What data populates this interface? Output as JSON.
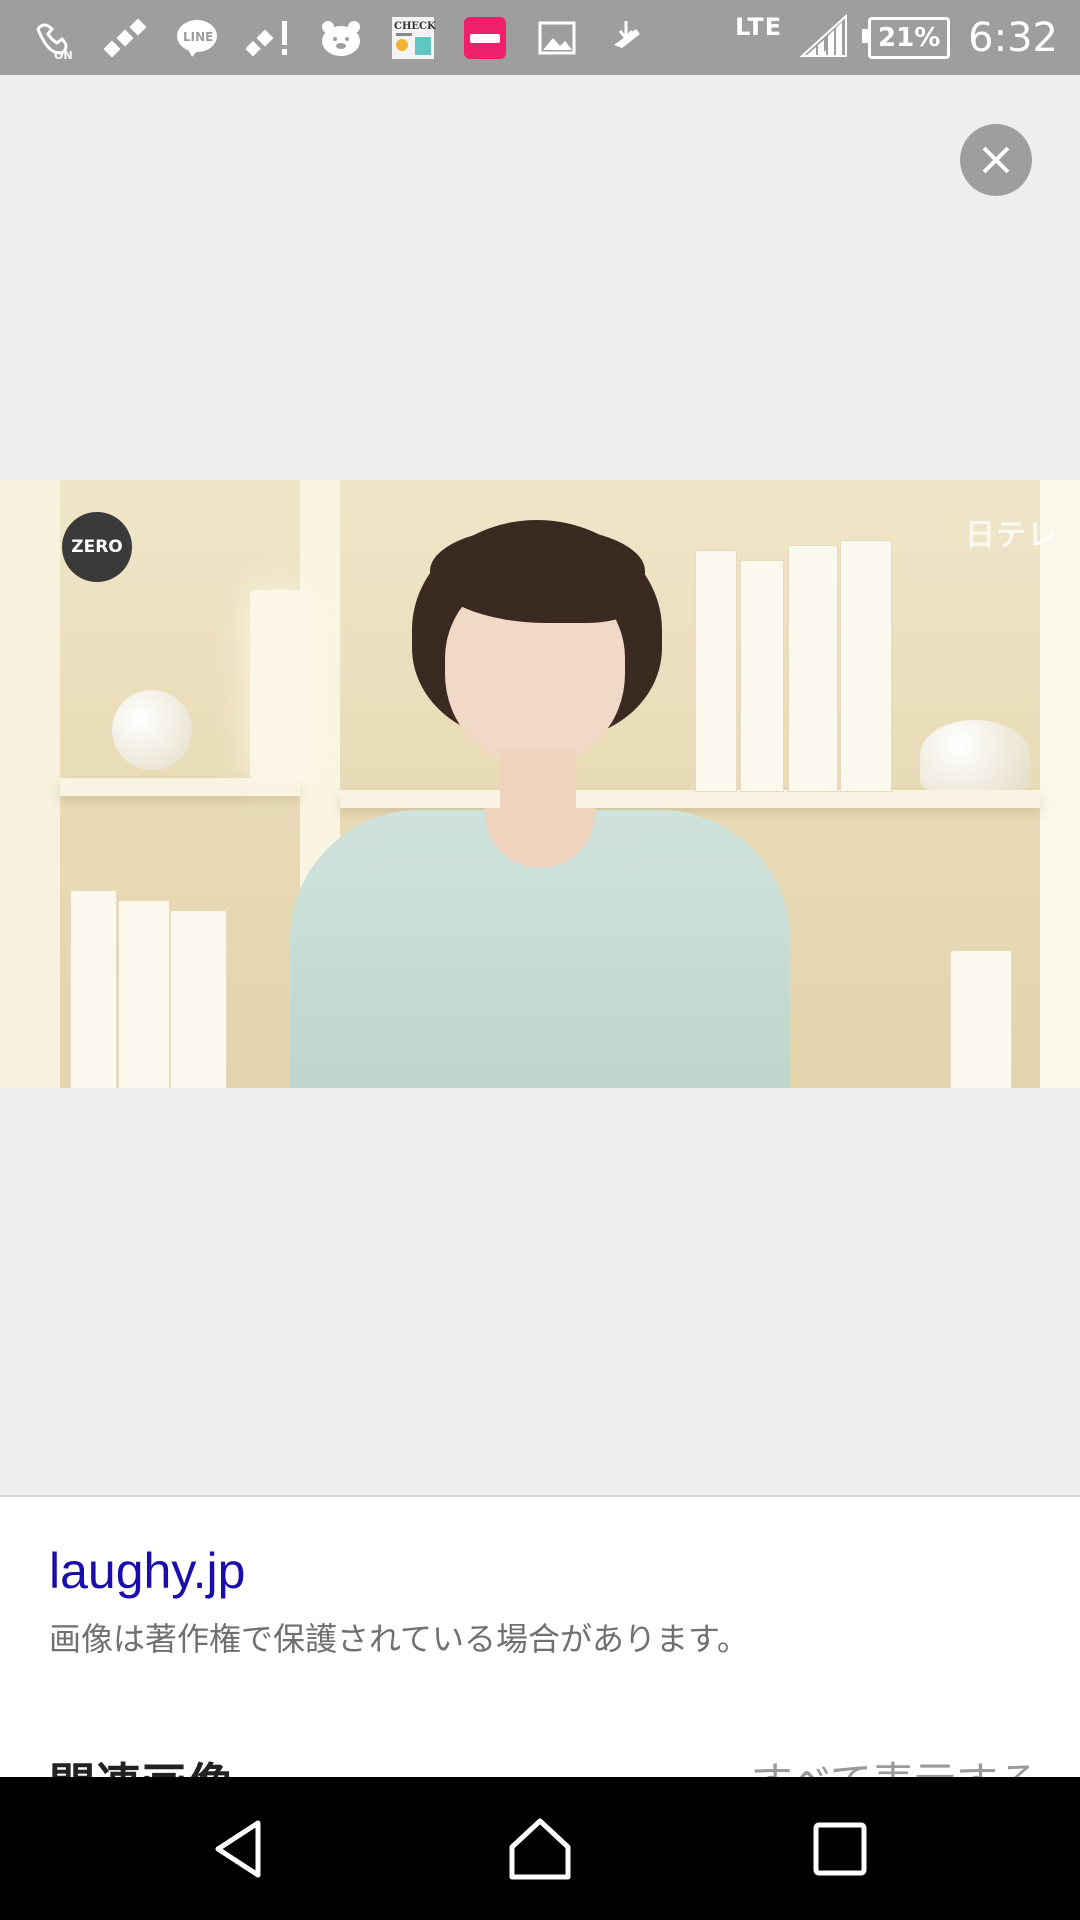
{
  "status_bar": {
    "icons": [
      "call-on-icon",
      "satellite-icon",
      "line-app-icon",
      "satellite-alert-icon",
      "bear-face-icon",
      "check-news-icon",
      "red-app-icon",
      "image-icon",
      "download-icon"
    ],
    "line_label": "LINE",
    "check_label": "CHECK",
    "on_label": "ON",
    "network": "LTE",
    "battery": "21%",
    "time": "6:32"
  },
  "image": {
    "overlay_logo_left": "ZERO",
    "overlay_logo_right": "日テレ"
  },
  "info": {
    "source": "laughy.jp",
    "notice": "画像は著作権で保護されている場合があります。"
  },
  "related": {
    "title": "関連画像",
    "show_all": "すべて表示する"
  },
  "colors": {
    "status_bar": "#9e9e9e",
    "background": "#eeeeee",
    "link": "#1a0dab",
    "nav_bar": "#000000"
  }
}
